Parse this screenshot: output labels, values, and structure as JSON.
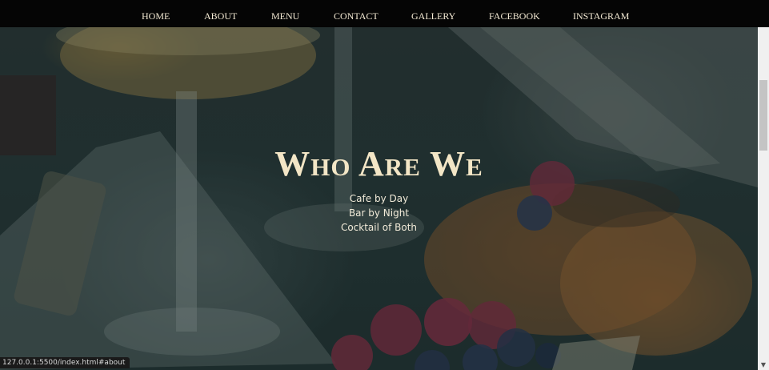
{
  "nav": {
    "items": [
      "HOME",
      "ABOUT",
      "MENU",
      "CONTACT",
      "GALLERY",
      "FACEBOOK",
      "INSTAGRAM"
    ]
  },
  "hero": {
    "title": "Who Are We",
    "lines": [
      "Cafe by Day",
      "Bar by Night",
      "Cocktail of Both"
    ]
  },
  "status_bar": {
    "url": "127.0.0.1:5500/index.html#about"
  },
  "colors": {
    "nav_bg": "#050505",
    "nav_text": "#f4ead4",
    "title": "#f3e6c6",
    "overlay": "#142626"
  }
}
